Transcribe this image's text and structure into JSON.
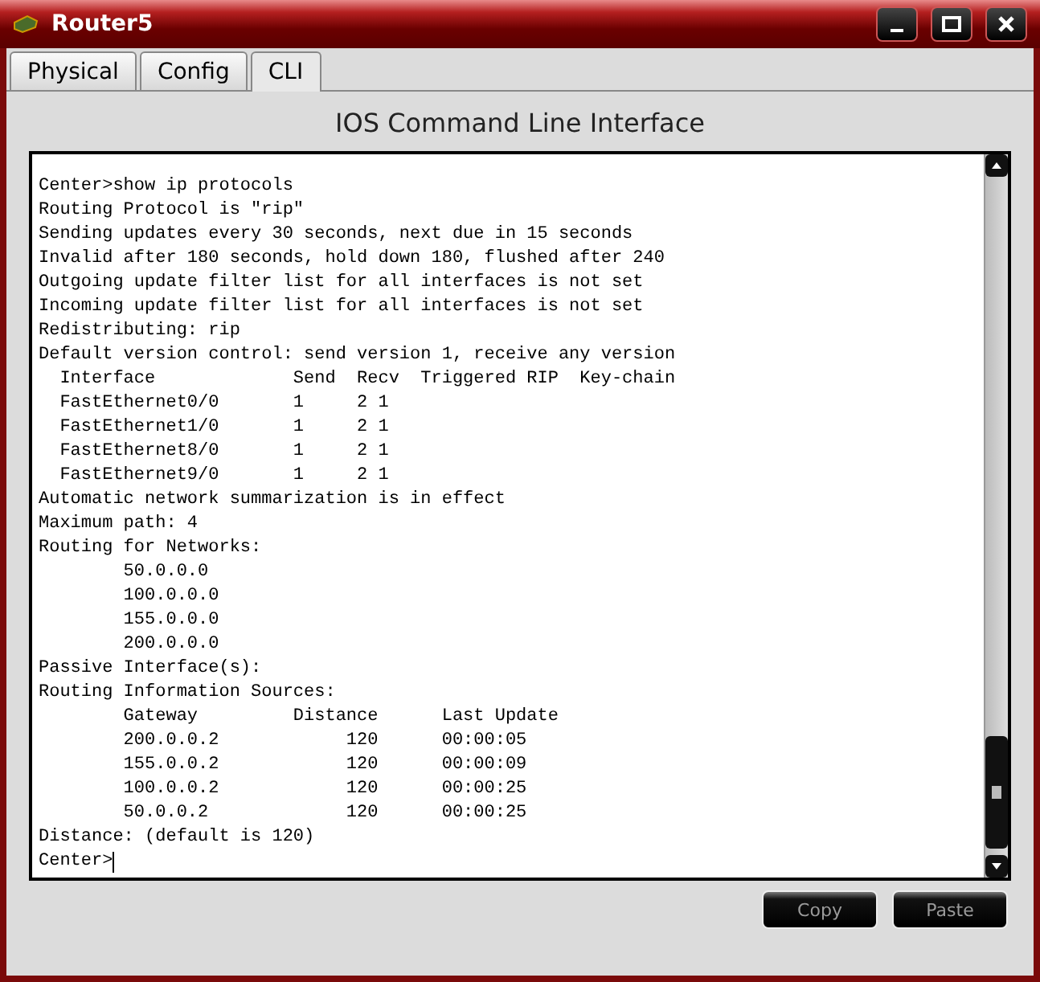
{
  "window": {
    "title": "Router5"
  },
  "tabs": [
    {
      "label": "Physical",
      "selected": false
    },
    {
      "label": "Config",
      "selected": false
    },
    {
      "label": "CLI",
      "selected": true
    }
  ],
  "panel": {
    "title": "IOS Command Line Interface"
  },
  "terminal": {
    "lines": [
      "Center>show ip protocols",
      "Routing Protocol is \"rip\"",
      "Sending updates every 30 seconds, next due in 15 seconds",
      "Invalid after 180 seconds, hold down 180, flushed after 240",
      "Outgoing update filter list for all interfaces is not set",
      "Incoming update filter list for all interfaces is not set",
      "Redistributing: rip",
      "Default version control: send version 1, receive any version",
      "  Interface             Send  Recv  Triggered RIP  Key-chain",
      "  FastEthernet0/0       1     2 1",
      "  FastEthernet1/0       1     2 1",
      "  FastEthernet8/0       1     2 1",
      "  FastEthernet9/0       1     2 1",
      "Automatic network summarization is in effect",
      "Maximum path: 4",
      "Routing for Networks:",
      "        50.0.0.0",
      "        100.0.0.0",
      "        155.0.0.0",
      "        200.0.0.0",
      "Passive Interface(s):",
      "Routing Information Sources:",
      "        Gateway         Distance      Last Update",
      "        200.0.0.2            120      00:00:05",
      "        155.0.0.2            120      00:00:09",
      "        100.0.0.2            120      00:00:25",
      "        50.0.0.2             120      00:00:25",
      "Distance: (default is 120)"
    ],
    "prompt": "Center>"
  },
  "buttons": [
    "Copy",
    "Paste"
  ]
}
